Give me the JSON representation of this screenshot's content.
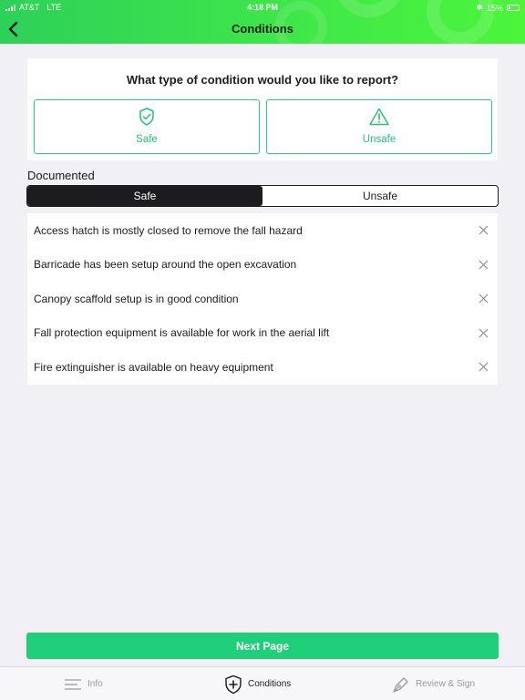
{
  "status_bar": {
    "carrier": "AT&T",
    "network": "LTE",
    "time": "4:18 PM",
    "battery": "15%"
  },
  "header": {
    "title": "Conditions",
    "back_icon": "chevron-left-icon",
    "background_colors": [
      "#2ed158",
      "#4cf53a"
    ]
  },
  "condition_type": {
    "question": "What type of condition would you like to report?",
    "options": [
      {
        "label": "Safe",
        "icon": "shield-check-icon"
      },
      {
        "label": "Unsafe",
        "icon": "warning-triangle-icon"
      }
    ],
    "accent_color": "#27c07a"
  },
  "documented": {
    "label": "Documented",
    "tabs": [
      {
        "label": "Safe",
        "selected": true
      },
      {
        "label": "Unsafe",
        "selected": false
      }
    ],
    "items": [
      "Access hatch is mostly closed to remove the fall hazard",
      "Barricade has been setup around the open excavation",
      "Canopy scaffold setup is in good condition",
      "Fall protection equipment is available for work in the aerial lift",
      "Fire extinguisher is available on heavy equipment"
    ],
    "remove_icon": "close-icon"
  },
  "next_button": {
    "label": "Next Page",
    "color": "#1fcf79"
  },
  "tabbar": {
    "items": [
      {
        "label": "Info",
        "icon": "menu-lines-icon",
        "active": false
      },
      {
        "label": "Conditions",
        "icon": "shield-plus-icon",
        "active": true
      },
      {
        "label": "Review & Sign",
        "icon": "pen-nib-icon",
        "active": false
      }
    ]
  }
}
